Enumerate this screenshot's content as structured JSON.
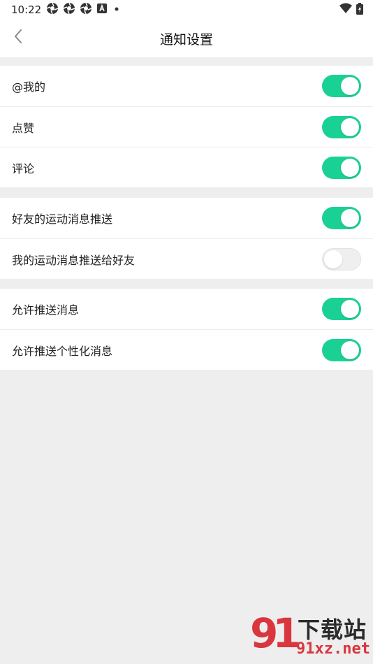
{
  "status_bar": {
    "time": "10:22",
    "notification_icons": [
      "aperture-icon",
      "aperture-icon",
      "aperture-icon",
      "a-box-icon",
      "dot-icon"
    ]
  },
  "header": {
    "title": "通知设置"
  },
  "groups": [
    {
      "rows": [
        {
          "label": "@我的",
          "enabled": true
        },
        {
          "label": "点赞",
          "enabled": true
        },
        {
          "label": "评论",
          "enabled": true
        }
      ]
    },
    {
      "rows": [
        {
          "label": "好友的运动消息推送",
          "enabled": true
        },
        {
          "label": "我的运动消息推送给好友",
          "enabled": false
        }
      ]
    },
    {
      "rows": [
        {
          "label": "允许推送消息",
          "enabled": true
        },
        {
          "label": "允许推送个性化消息",
          "enabled": true
        }
      ]
    }
  ],
  "watermark": {
    "logo": "91",
    "site_name": "下载站",
    "url": "91xz.net"
  },
  "colors": {
    "toggle_on": "#1ad195",
    "toggle_off": "#efefef",
    "background": "#eeeeee",
    "watermark_red": "#d9363e"
  }
}
